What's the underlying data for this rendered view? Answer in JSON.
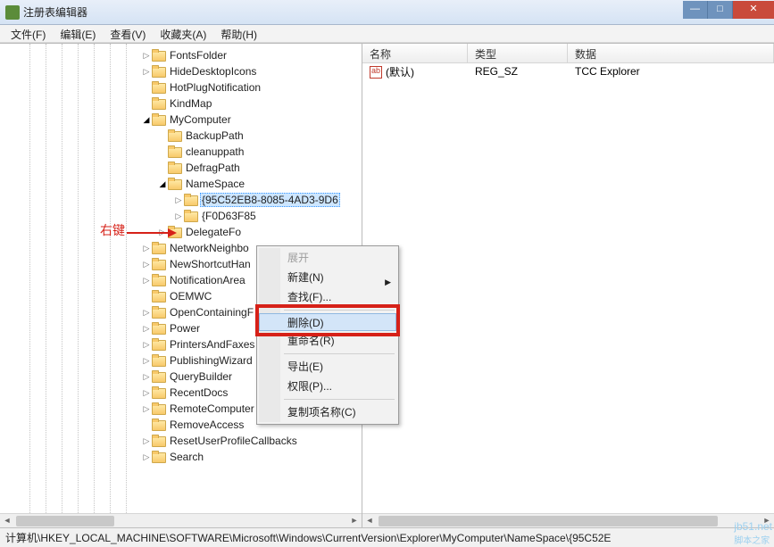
{
  "window": {
    "title": "注册表编辑器"
  },
  "menu": {
    "file": "文件(F)",
    "edit": "编辑(E)",
    "view": "查看(V)",
    "favorites": "收藏夹(A)",
    "help": "帮助(H)"
  },
  "annotation": {
    "text": "右键"
  },
  "tree": {
    "items": [
      {
        "indent": 158,
        "tri": "closed",
        "label": "FontsFolder"
      },
      {
        "indent": 158,
        "tri": "closed",
        "label": "HideDesktopIcons"
      },
      {
        "indent": 158,
        "tri": "none",
        "label": "HotPlugNotification"
      },
      {
        "indent": 158,
        "tri": "none",
        "label": "KindMap"
      },
      {
        "indent": 158,
        "tri": "open",
        "label": "MyComputer"
      },
      {
        "indent": 176,
        "tri": "none",
        "label": "BackupPath"
      },
      {
        "indent": 176,
        "tri": "none",
        "label": "cleanuppath"
      },
      {
        "indent": 176,
        "tri": "none",
        "label": "DefragPath"
      },
      {
        "indent": 176,
        "tri": "open",
        "label": "NameSpace"
      },
      {
        "indent": 194,
        "tri": "closed",
        "label": "{95C52EB8-8085-4AD3-9D6",
        "selected": true
      },
      {
        "indent": 194,
        "tri": "closed",
        "label": "{F0D63F85"
      },
      {
        "indent": 176,
        "tri": "closed",
        "label": "DelegateFo"
      },
      {
        "indent": 158,
        "tri": "closed",
        "label": "NetworkNeighbo"
      },
      {
        "indent": 158,
        "tri": "closed",
        "label": "NewShortcutHan"
      },
      {
        "indent": 158,
        "tri": "closed",
        "label": "NotificationArea"
      },
      {
        "indent": 158,
        "tri": "none",
        "label": "OEMWC"
      },
      {
        "indent": 158,
        "tri": "closed",
        "label": "OpenContainingF"
      },
      {
        "indent": 158,
        "tri": "closed",
        "label": "Power"
      },
      {
        "indent": 158,
        "tri": "closed",
        "label": "PrintersAndFaxes"
      },
      {
        "indent": 158,
        "tri": "closed",
        "label": "PublishingWizard"
      },
      {
        "indent": 158,
        "tri": "closed",
        "label": "QueryBuilder"
      },
      {
        "indent": 158,
        "tri": "closed",
        "label": "RecentDocs"
      },
      {
        "indent": 158,
        "tri": "closed",
        "label": "RemoteComputer"
      },
      {
        "indent": 158,
        "tri": "none",
        "label": "RemoveAccess"
      },
      {
        "indent": 158,
        "tri": "closed",
        "label": "ResetUserProfileCallbacks"
      },
      {
        "indent": 158,
        "tri": "closed",
        "label": "Search"
      }
    ]
  },
  "list": {
    "headers": {
      "name": "名称",
      "type": "类型",
      "data": "数据"
    },
    "rows": [
      {
        "name": "(默认)",
        "type": "REG_SZ",
        "data": "TCC Explorer"
      }
    ]
  },
  "context_menu": {
    "items": [
      {
        "label": "展开",
        "disabled": true
      },
      {
        "label": "新建(N)",
        "submenu": true
      },
      {
        "label": "查找(F)..."
      },
      {
        "sep": true
      },
      {
        "label": "删除(D)",
        "hover": true
      },
      {
        "label": "重命名(R)"
      },
      {
        "sep": true
      },
      {
        "label": "导出(E)"
      },
      {
        "label": "权限(P)..."
      },
      {
        "sep": true
      },
      {
        "label": "复制项名称(C)"
      }
    ]
  },
  "statusbar": {
    "path": "计算机\\HKEY_LOCAL_MACHINE\\SOFTWARE\\Microsoft\\Windows\\CurrentVersion\\Explorer\\MyComputer\\NameSpace\\{95C52E"
  },
  "watermark": {
    "line1": "jb51.net",
    "line2": "脚本之家"
  }
}
